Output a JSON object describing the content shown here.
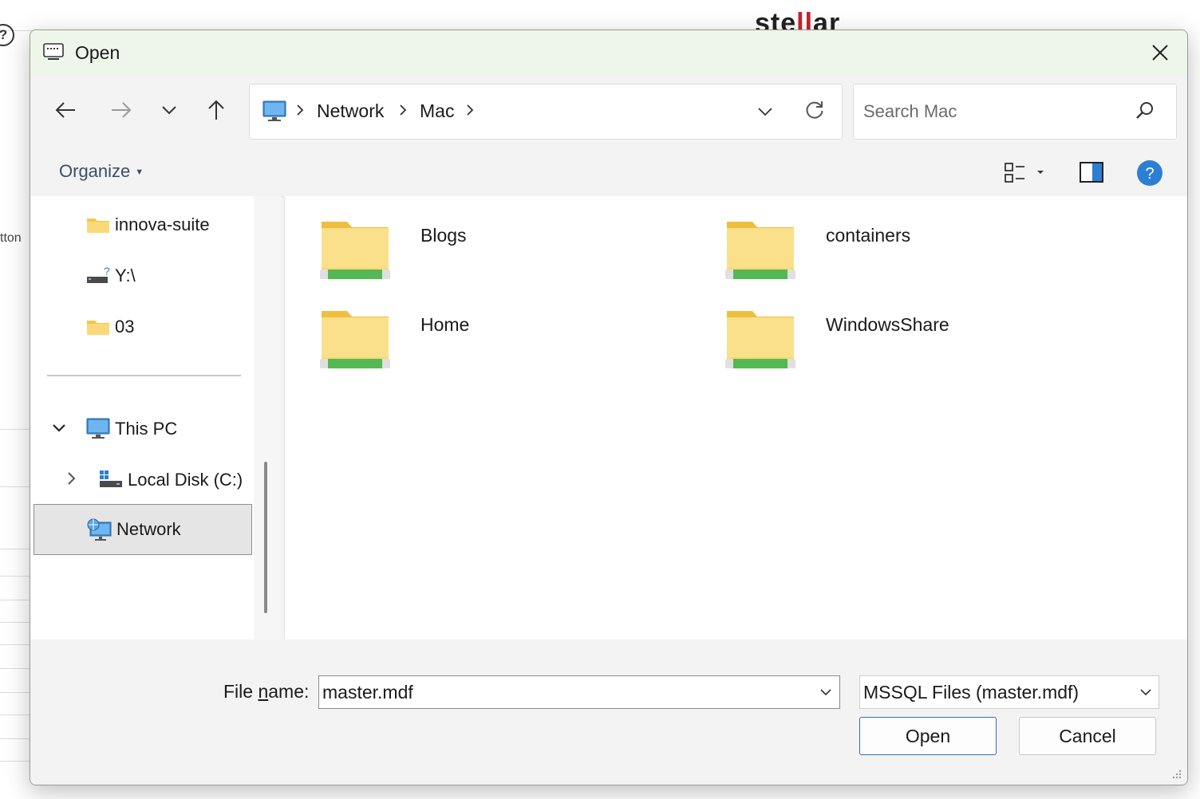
{
  "background": {
    "logo_prefix": "ste",
    "logo_mid": "ll",
    "logo_suffix": "ar",
    "help_glyph": "?",
    "side_text": "tton"
  },
  "dialog": {
    "title": "Open",
    "title_icon": "dialog-window-icon",
    "close_icon": "close-icon"
  },
  "navigation": {
    "back_icon": "arrow-left-icon",
    "forward_icon": "arrow-right-icon",
    "recent_icon": "chevron-down-icon",
    "up_icon": "arrow-up-icon"
  },
  "address_bar": {
    "root_icon": "this-pc-icon",
    "breadcrumbs": [
      "Network",
      "Mac"
    ],
    "dropdown_icon": "chevron-down-icon",
    "refresh_icon": "refresh-icon"
  },
  "search": {
    "placeholder": "Search Mac",
    "value": "",
    "icon": "search-icon"
  },
  "toolbar": {
    "organize_label": "Organize",
    "view_icon": "view-options-icon",
    "preview_icon": "preview-pane-icon",
    "help_icon": "help-icon",
    "help_glyph": "?"
  },
  "nav_pane": {
    "items": [
      {
        "label": "innova-suite",
        "icon": "folder-icon"
      },
      {
        "label": "Y:\\",
        "icon": "disconnected-drive-icon"
      },
      {
        "label": "03",
        "icon": "folder-icon"
      },
      {
        "label": "This PC",
        "icon": "this-pc-icon",
        "expanded": true
      },
      {
        "label": "Local Disk (C:)",
        "icon": "local-disk-icon",
        "expanded": false
      },
      {
        "label": "Network",
        "icon": "network-icon",
        "selected": true
      }
    ]
  },
  "content": {
    "folders": [
      {
        "name": "Blogs",
        "icon": "network-share-folder-icon"
      },
      {
        "name": "containers",
        "icon": "network-share-folder-icon"
      },
      {
        "name": "Home",
        "icon": "network-share-folder-icon"
      },
      {
        "name": "WindowsShare",
        "icon": "network-share-folder-icon"
      }
    ]
  },
  "footer": {
    "file_name_label_pre": "File ",
    "file_name_label_key": "n",
    "file_name_label_post": "ame:",
    "file_name_value": "master.mdf",
    "file_type_value": "MSSQL Files (master.mdf)",
    "open_label": "Open",
    "cancel_label": "Cancel"
  },
  "colors": {
    "title_bar": "#eef6e9",
    "accent": "#2f6fb6",
    "help_blue": "#2d7fd3",
    "folder_yellow": "#f7d36b",
    "share_green": "#5cc05c"
  }
}
